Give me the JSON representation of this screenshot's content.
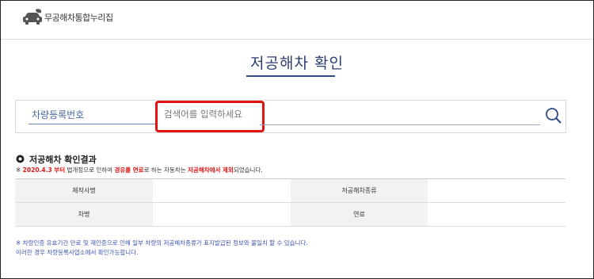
{
  "header": {
    "logo_icon": "car-leaf-icon",
    "logo_text": "무공해차통합누리집"
  },
  "page": {
    "title": "저공해차 확인"
  },
  "search": {
    "select_value": "차량등록번호",
    "input_placeholder": "검색어를 입력하세요",
    "search_icon": "search-icon",
    "highlight_color": "#e31313"
  },
  "result": {
    "title": "저공해차 확인결과",
    "notice": {
      "prefix": "※ ",
      "date": "2020.4.3 부터",
      "part1": " 법개정으로 인하여 ",
      "fuel": "경유를 연료",
      "part2": "로 하는 자동차는 ",
      "excluded": "저공해차에서 제외",
      "part3": "되었습니다."
    },
    "table": {
      "row1": {
        "label1": "제작사명",
        "value1": "",
        "label2": "저공해차종류",
        "value2": ""
      },
      "row2": {
        "label1": "차명",
        "value1": "",
        "label2": "연료",
        "value2": ""
      }
    }
  },
  "footnote": {
    "line1": "※ 차량인증 유효기간 만료 및 재인증으로 인해 일부 차량의 저공해차종류가 표지발급된 정보와 불일치 할 수 있습니다.",
    "line2": "이러한 경우 차량등록사업소에서 확인가능합니다."
  },
  "colors": {
    "accent": "#2c3e74",
    "red": "#e31313",
    "link_blue": "#3a53b8"
  }
}
